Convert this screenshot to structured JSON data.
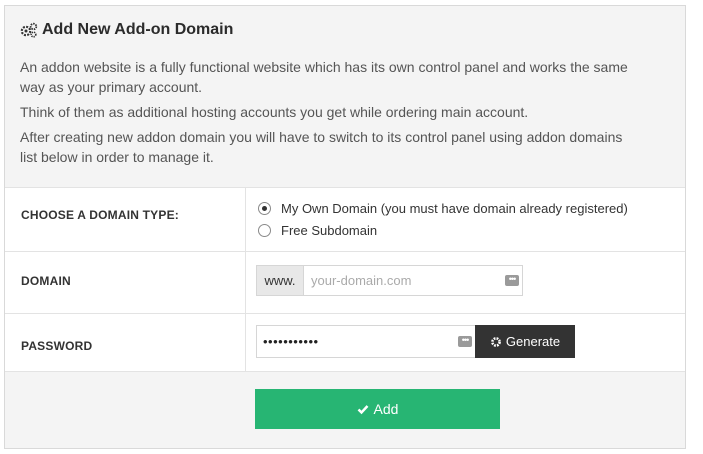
{
  "header": {
    "title": "Add New Add-on Domain",
    "paragraphs": [
      "An addon website is a fully functional website which has its own control panel and works the same way as your primary account.",
      "Think of them as additional hosting accounts you get while ordering main account.",
      "After creating new addon domain you will have to switch to its control panel using addon domains list below in order to manage it."
    ]
  },
  "form": {
    "domain_type": {
      "label": "CHOOSE A DOMAIN TYPE:",
      "options": [
        {
          "label": "My Own Domain (you must have domain already registered)",
          "checked": true
        },
        {
          "label": "Free Subdomain",
          "checked": false
        }
      ]
    },
    "domain": {
      "label": "DOMAIN",
      "prefix": "www.",
      "placeholder": "your-domain.com",
      "value": ""
    },
    "password": {
      "label": "PASSWORD",
      "value": "•••••••••••",
      "generate_label": "Generate"
    },
    "submit_label": "Add"
  },
  "colors": {
    "accent_green": "#27b573",
    "dark_button": "#333333",
    "panel_bg": "#f4f4f4"
  },
  "icons": [
    "gears-icon",
    "dots-icon",
    "cog-icon",
    "check-icon"
  ]
}
